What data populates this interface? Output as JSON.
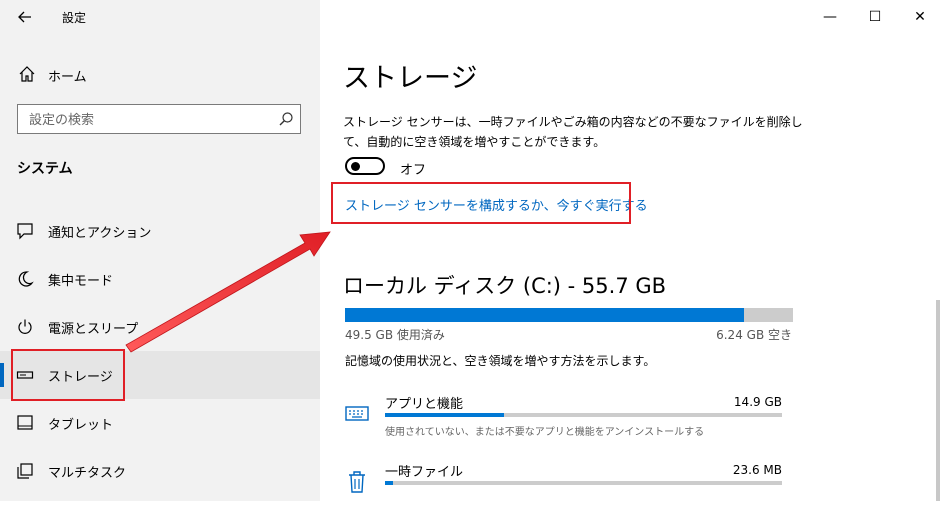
{
  "window": {
    "title": "設定",
    "minimize_glyph": "—",
    "maximize_glyph": "☐",
    "close_glyph": "✕"
  },
  "sidebar": {
    "home_label": "ホーム",
    "search_placeholder": "設定の検索",
    "section_title": "システム",
    "items": [
      {
        "label": "通知とアクション",
        "icon": "notification-icon"
      },
      {
        "label": "集中モード",
        "icon": "moon-icon"
      },
      {
        "label": "電源とスリープ",
        "icon": "power-icon"
      },
      {
        "label": "ストレージ",
        "icon": "drive-icon",
        "active": true
      },
      {
        "label": "タブレット",
        "icon": "tablet-icon"
      },
      {
        "label": "マルチタスク",
        "icon": "multitask-icon"
      }
    ]
  },
  "main": {
    "title": "ストレージ",
    "description": "ストレージ センサーは、一時ファイルやごみ箱の内容などの不要なファイルを削除して、自動的に空き領域を増やすことができます。",
    "toggle_state": "オフ",
    "link_text": "ストレージ センサーを構成するか、今すぐ実行する",
    "disk": {
      "title": "ローカル ディスク (C:) - 55.7 GB",
      "used_text": "49.5 GB 使用済み",
      "free_text": "6.24 GB 空き",
      "used_fraction": 0.89
    },
    "usage_intro": "記憶域の使用状況と、空き領域を増やす方法を示します。",
    "categories": [
      {
        "name": "アプリと機能",
        "size": "14.9 GB",
        "description": "使用されていない、または不要なアプリと機能をアンインストールする",
        "icon": "keyboard-icon",
        "fraction": 0.3
      },
      {
        "name": "一時ファイル",
        "size": "23.6 MB",
        "description": "",
        "icon": "trash-icon",
        "fraction": 0.02
      }
    ]
  },
  "colors": {
    "accent": "#0078d4",
    "link": "#0067c0",
    "highlight": "#e01f26"
  }
}
